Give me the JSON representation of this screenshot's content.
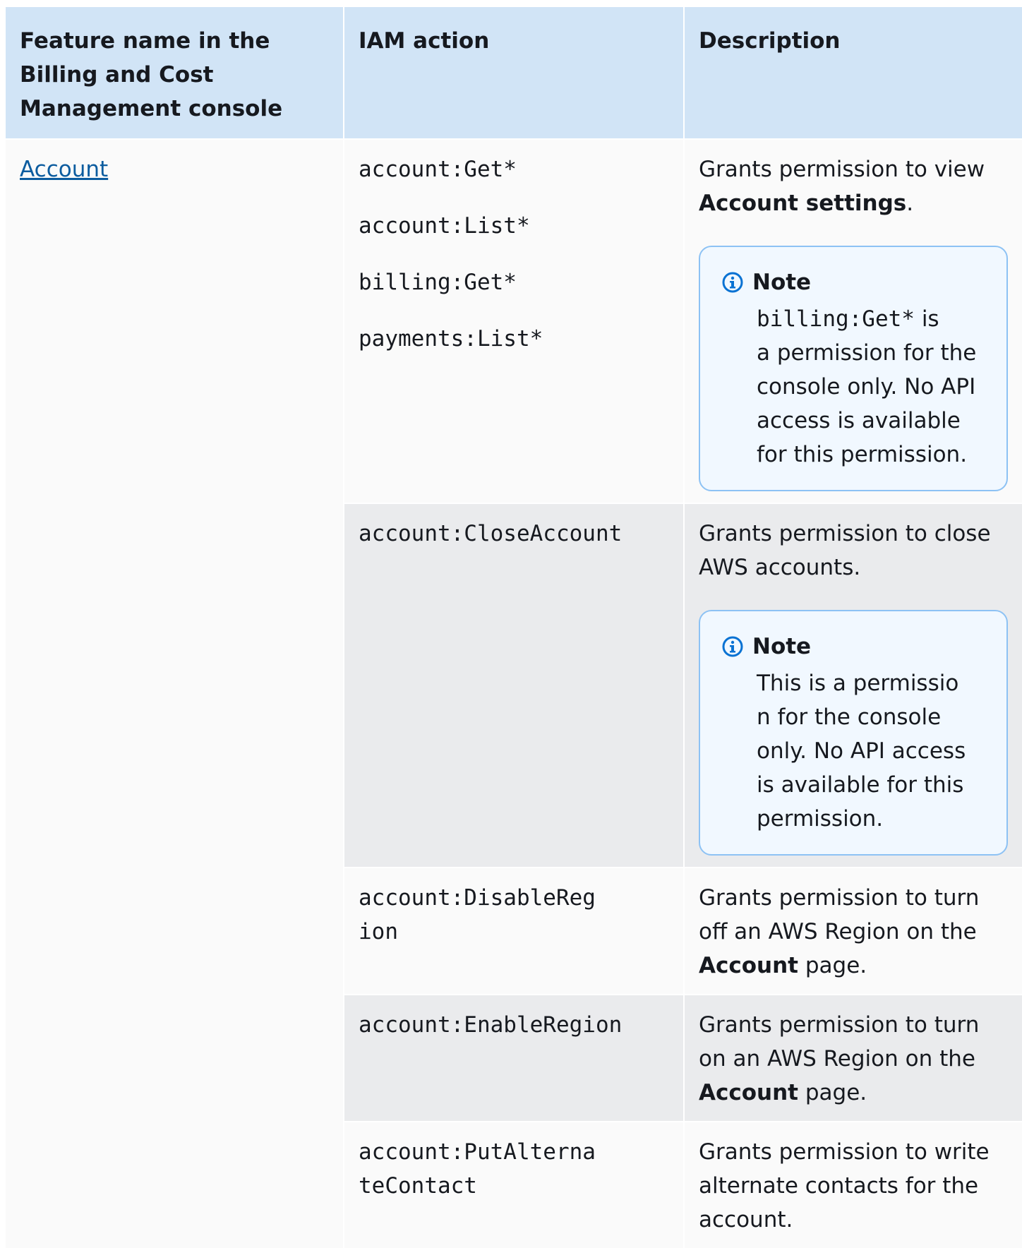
{
  "table": {
    "headers": [
      "Feature name in the Billing and Cost Management console",
      "IAM action",
      "Description"
    ],
    "feature_link": "Account",
    "rows": [
      {
        "actions": [
          "account:Get*",
          "account:List*",
          "billing:Get*",
          "payments:List*"
        ],
        "desc": {
          "pre": "Grants permission to view ",
          "bold": "Account settings",
          "post": "."
        },
        "note": {
          "title": "Note",
          "code": "billing:Get*",
          "text_line1": " is",
          "text_rest": "a permission for the console only. No API access is available for this permission."
        }
      },
      {
        "actions": [
          "account:CloseAccount"
        ],
        "desc": {
          "pre": "Grants permission to close AWS accounts.",
          "bold": "",
          "post": ""
        },
        "note": {
          "title": "Note",
          "lines": [
            "This is a permissio",
            "n for the console",
            "only. No API access",
            "is available for this",
            "permission."
          ]
        }
      },
      {
        "actions": [
          "account:DisableReg\nion"
        ],
        "desc": {
          "pre": "Grants permission to turn off an AWS Region on the ",
          "bold": "Account",
          "post": " page."
        }
      },
      {
        "actions": [
          "account:EnableRegion"
        ],
        "desc": {
          "pre": "Grants permission to turn on an AWS Region on the ",
          "bold": "Account",
          "post": " page."
        }
      },
      {
        "actions": [
          "account:PutAlterna\nteContact"
        ],
        "desc": {
          "pre": "Grants permission to write alternate contacts for the account.",
          "bold": "",
          "post": ""
        }
      }
    ]
  },
  "icons": {
    "note": "info-circle-icon"
  },
  "colors": {
    "header_bg": "#d1e4f6",
    "row_light": "#fafafa",
    "row_dark": "#eaebed",
    "link": "#0c5c9f",
    "note_border": "#8dc2f4",
    "note_bg": "#f1f8ff",
    "icon": "#0972d3"
  }
}
